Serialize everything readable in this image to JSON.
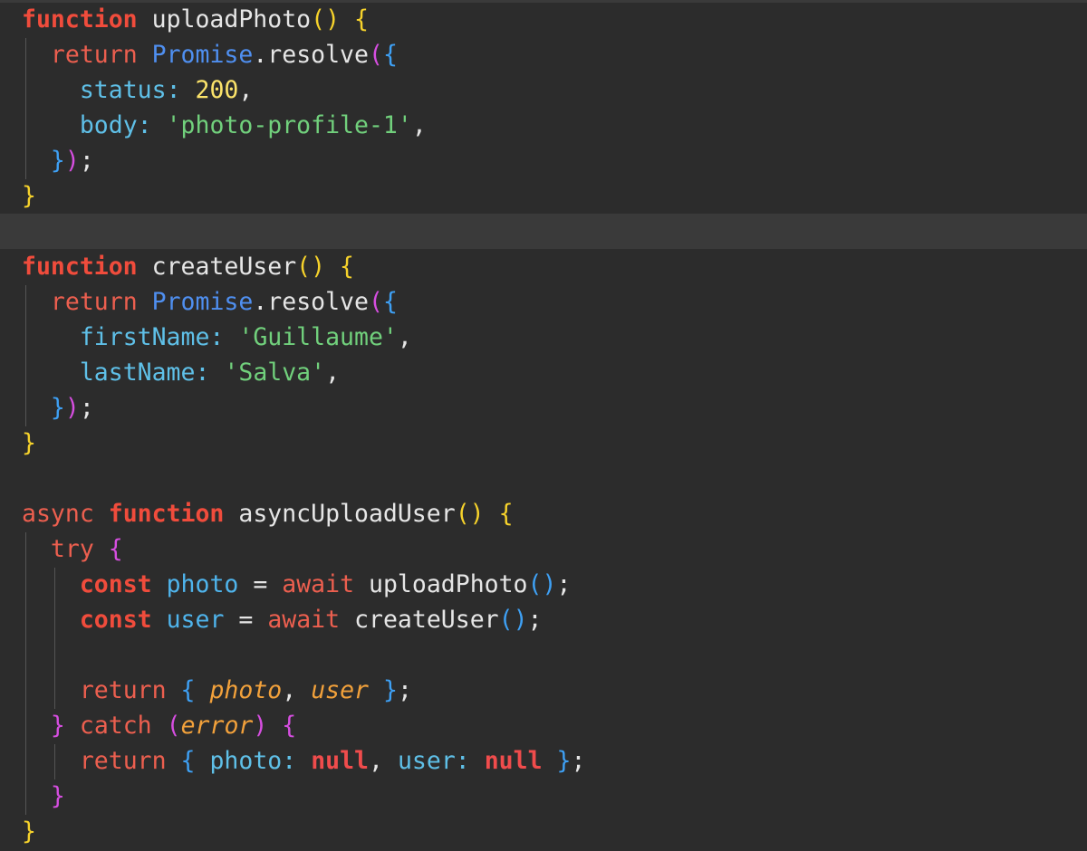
{
  "colors": {
    "background": "#2c2c2c",
    "keyword": "#f04c3c",
    "string": "#71d07c",
    "number": "#fbe36a",
    "class": "#4f8ff0",
    "property": "#5fc0e8",
    "bracket_yellow": "#f6d22b",
    "bracket_blue": "#3ea0f4",
    "bracket_magenta": "#d64ee0"
  },
  "code": {
    "kw_function": "function",
    "kw_return": "return",
    "kw_async": "async",
    "kw_try": "try",
    "kw_const": "const",
    "kw_await": "await",
    "kw_catch": "catch",
    "kw_null": "null",
    "fn_uploadPhoto": "uploadPhoto",
    "fn_createUser": "createUser",
    "fn_asyncUploadUser": "asyncUploadUser",
    "cls_promise": "Promise",
    "method_resolve": "resolve",
    "prop_status": "status",
    "prop_body": "body",
    "prop_firstName": "firstName",
    "prop_lastName": "lastName",
    "prop_photo": "photo",
    "prop_user": "user",
    "num_200": "200",
    "str_photo_profile": "'photo-profile-1'",
    "str_guillaume": "'Guillaume'",
    "str_salva": "'Salva'",
    "var_photo": "photo",
    "var_user": "user",
    "var_error": "error"
  }
}
